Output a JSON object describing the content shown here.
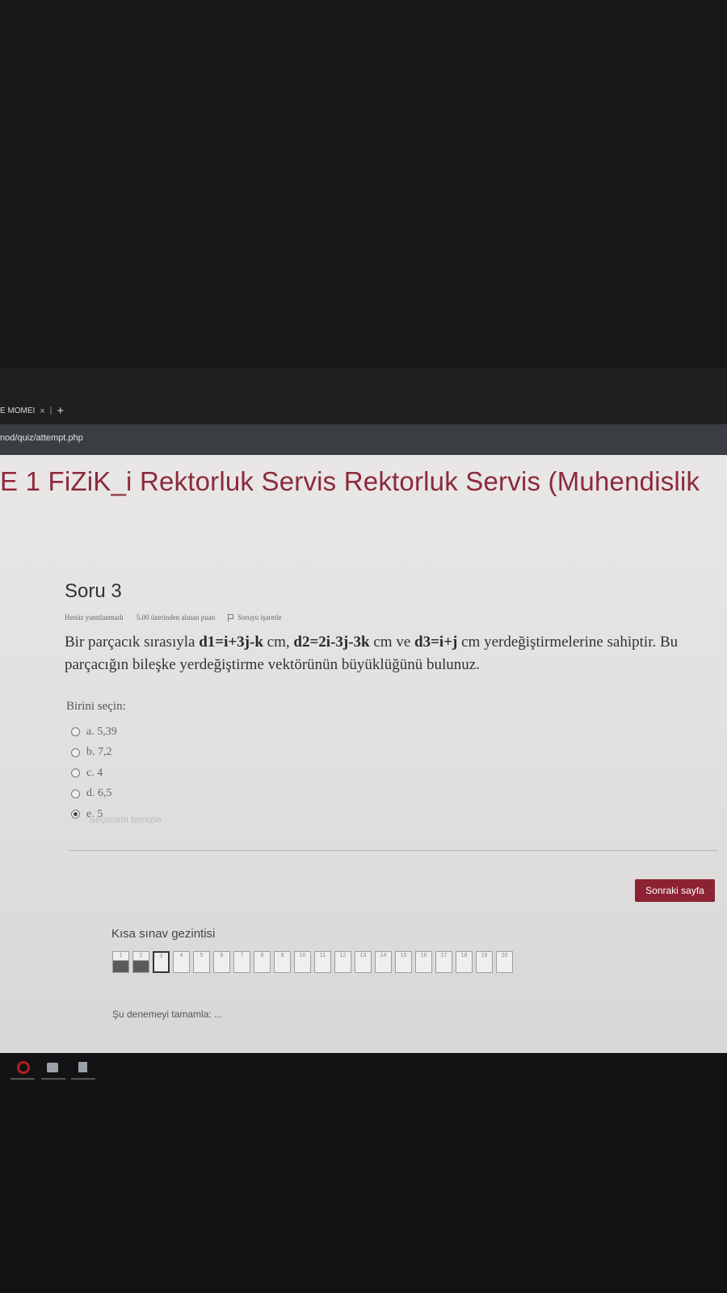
{
  "browser": {
    "tab_title": "E MOMEI",
    "tab_close": "×",
    "new_tab": "+",
    "url": "nod/quiz/attempt.php"
  },
  "page": {
    "course_title": "E 1 FiZiK_i Rektorluk Servis Rektorluk Servis (Muhendislik",
    "question": {
      "title": "Soru 3",
      "status": "Henüz yanıtlanmadı",
      "points": "5.00 üzerinden alınan puan",
      "flag_label": "Soruyu işaretle",
      "text_parts": {
        "p1": "Bir parçacık sırasıyla ",
        "d1": "d1=i+3j-k",
        "p2": " cm, ",
        "d2": "d2=2i-3j-3k",
        "p3": " cm ve ",
        "d3": "d3=i+j",
        "p4": " cm yerdeğiştirmelerine sahiptir. Bu parçacığın bileşke yerdeğiştirme vektörünün büyüklüğünü bulunuz."
      },
      "choose_label": "Birini seçin:",
      "answers": [
        {
          "label": "a. 5,39",
          "selected": false
        },
        {
          "label": "b. 7,2",
          "selected": false
        },
        {
          "label": "c. 4",
          "selected": false
        },
        {
          "label": "d. 6,5",
          "selected": false
        },
        {
          "label": "e. 5",
          "selected": true
        }
      ],
      "clear_label": "Seçimimi temizle"
    },
    "next_button": "Sonraki sayfa",
    "quiz_nav": {
      "title": "Kısa sınav gezintisi",
      "items": [
        {
          "num": "1",
          "state": "answered"
        },
        {
          "num": "2",
          "state": "answered"
        },
        {
          "num": "3",
          "state": "current"
        },
        {
          "num": "4",
          "state": "empty"
        },
        {
          "num": "5",
          "state": "empty"
        },
        {
          "num": "6",
          "state": "empty"
        },
        {
          "num": "7",
          "state": "empty"
        },
        {
          "num": "8",
          "state": "empty"
        },
        {
          "num": "9",
          "state": "empty"
        },
        {
          "num": "10",
          "state": "empty"
        },
        {
          "num": "11",
          "state": "empty"
        },
        {
          "num": "12",
          "state": "empty"
        },
        {
          "num": "13",
          "state": "empty"
        },
        {
          "num": "14",
          "state": "empty"
        },
        {
          "num": "15",
          "state": "empty"
        },
        {
          "num": "16",
          "state": "empty"
        },
        {
          "num": "17",
          "state": "empty"
        },
        {
          "num": "18",
          "state": "empty"
        },
        {
          "num": "19",
          "state": "empty"
        },
        {
          "num": "20",
          "state": "empty"
        }
      ],
      "finish_label": "Şu denemeyi tamamla: ..."
    }
  },
  "taskbar": {
    "icons": [
      "opera-browser-icon",
      "app-icon",
      "document-icon"
    ]
  }
}
